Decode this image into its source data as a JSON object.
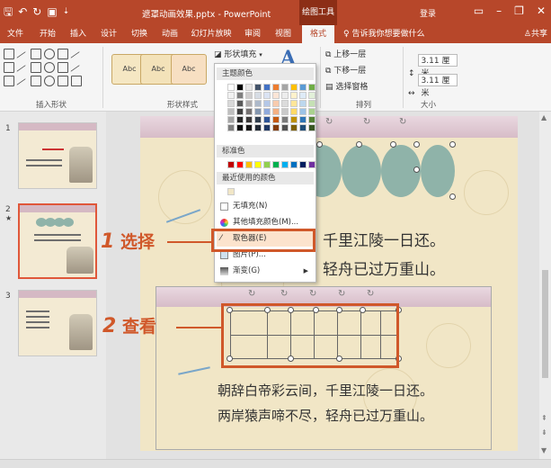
{
  "app": {
    "title": "遮罩动画效果.pptx - PowerPoint",
    "context_tab": "绘图工具",
    "login": "登录",
    "share": "共享",
    "tell_me": "告诉我你想要做什么"
  },
  "tabs": [
    "文件",
    "开始",
    "插入",
    "设计",
    "切换",
    "动画",
    "幻灯片放映",
    "审阅",
    "视图",
    "格式"
  ],
  "active_tab": "格式",
  "ribbon": {
    "groups": [
      "插入形状",
      "形状样式",
      "排列",
      "大小"
    ],
    "style_samples": [
      "Abc",
      "Abc",
      "Abc"
    ],
    "shape_fill": "形状填充",
    "arrange": [
      "上移一层",
      "下移一层",
      "选择窗格"
    ],
    "size": {
      "height": "3.11 厘米",
      "width": "3.11 厘米"
    }
  },
  "slides": {
    "numbers": [
      "1",
      "2",
      "3"
    ],
    "selected": 2
  },
  "slide": {
    "poem_line1": "朝辞白帝彩云间，千里江陵一日还。",
    "poem_line2": "两岸猿声啼不尽，轻舟已过万重山。",
    "visible_line1": "，千里江陵一日还。",
    "visible_line2": "，轻舟已过万重山。"
  },
  "dropdown": {
    "theme_colors": "主题颜色",
    "standard_colors": "标准色",
    "recent_colors": "最近使用的颜色",
    "items": [
      "无填充(N)",
      "其他填充颜色(M)...",
      "取色器(E)",
      "图片(P)...",
      "渐变(G)"
    ],
    "highlighted": "取色器(E)"
  },
  "callouts": {
    "step1_num": "1",
    "step1_text": "选择",
    "step2_num": "2",
    "step2_text": "查看"
  },
  "colors": {
    "accent": "#b7472a",
    "callout": "#d0582a",
    "slide_bg": "#f1e6c6",
    "circle": "#8fb3a9"
  },
  "theme_palette": [
    [
      "#ffffff",
      "#000000",
      "#e7e6e6",
      "#44546a",
      "#4472c4",
      "#ed7d31",
      "#a5a5a5",
      "#ffc000",
      "#5b9bd5",
      "#70ad47"
    ],
    [
      "#f2f2f2",
      "#7f7f7f",
      "#d0cece",
      "#d6dce4",
      "#dae3f3",
      "#fbe5d6",
      "#ededed",
      "#fff2cc",
      "#deebf7",
      "#e2f0d9"
    ],
    [
      "#d8d8d8",
      "#595959",
      "#aeabab",
      "#adb9ca",
      "#b4c7e7",
      "#f8cbad",
      "#dbdbdb",
      "#ffe699",
      "#bdd7ee",
      "#c5e0b4"
    ],
    [
      "#bfbfbf",
      "#3f3f3f",
      "#757171",
      "#8497b0",
      "#8faadc",
      "#f4b183",
      "#c9c9c9",
      "#ffd966",
      "#9dc3e6",
      "#a9d18e"
    ],
    [
      "#a5a5a5",
      "#262626",
      "#3a3838",
      "#323f4f",
      "#2f5597",
      "#c55a11",
      "#7b7b7b",
      "#bf9000",
      "#2e75b6",
      "#548235"
    ],
    [
      "#7f7f7f",
      "#0c0c0c",
      "#171616",
      "#222a35",
      "#203864",
      "#843c0c",
      "#525252",
      "#7f6000",
      "#1f4e79",
      "#385723"
    ]
  ],
  "standard_palette": [
    "#c00000",
    "#ff0000",
    "#ffc000",
    "#ffff00",
    "#92d050",
    "#00b050",
    "#00b0f0",
    "#0070c0",
    "#002060",
    "#7030a0"
  ]
}
